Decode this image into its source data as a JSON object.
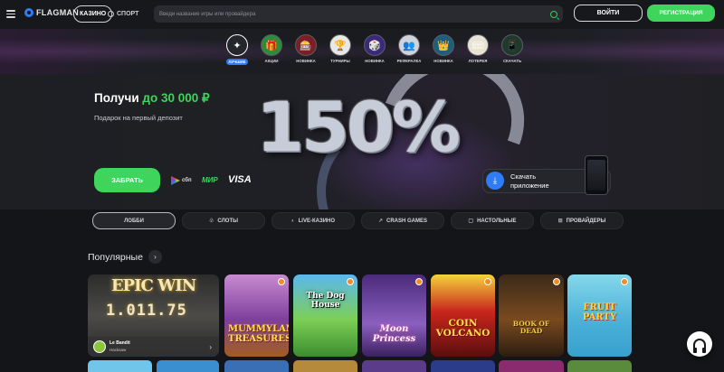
{
  "header": {
    "logo_text": "FLAGMAN",
    "nav_casino": "КАЗИНО",
    "nav_sport": "СПОРТ",
    "search_placeholder": "Введи название игры или провайдера",
    "login": "ВОЙТИ",
    "register": "РЕГИСТРАЦИЯ"
  },
  "categories": [
    {
      "label": "ЛУЧШИЕ",
      "icon": "star-icon"
    },
    {
      "label": "АКЦИИ",
      "icon": "gift-icon"
    },
    {
      "label": "НОВИНКА",
      "icon": "game-icon"
    },
    {
      "label": "ТУРНИРЫ",
      "icon": "trophy-icon"
    },
    {
      "label": "НОВИНКА",
      "icon": "game-icon"
    },
    {
      "label": "РЕФЕРАЛКА",
      "icon": "referral-icon"
    },
    {
      "label": "НОВИНКА",
      "icon": "game-icon"
    },
    {
      "label": "ЛОТЕРЕЯ",
      "icon": "lottery-icon"
    },
    {
      "label": "СКАЧАТЬ",
      "icon": "download-icon"
    }
  ],
  "banner": {
    "title_prefix": "Получи",
    "title_accent": "до 30 000 ₽",
    "subtitle": "Подарок на первый депозит",
    "big_text": "150%",
    "claim_button": "ЗАБРАТЬ",
    "pay_sbp": "сбп",
    "pay_mir": "МИР",
    "pay_visa": "VISA",
    "app_line1": "Скачать",
    "app_line2": "приложение"
  },
  "tabs": [
    {
      "label": "ЛОББИ",
      "icon": "",
      "active": true
    },
    {
      "label": "СЛОТЫ",
      "icon": "slots-icon"
    },
    {
      "label": "LIVE-КАЗИНО",
      "icon": "live-icon"
    },
    {
      "label": "CRASH GAMES",
      "icon": "crash-icon"
    },
    {
      "label": "НАСТОЛЬНЫЕ",
      "icon": "table-games-icon"
    },
    {
      "label": "ПРОВАЙДЕРЫ",
      "icon": "providers-icon"
    }
  ],
  "popular": {
    "title": "Популярные",
    "games": [
      {
        "name": "EPIC WIN",
        "counter": "1.011.75",
        "provider": "Le Bandit",
        "provider_sub": "Hacksaw"
      },
      {
        "name": "MUMMYLAND TREASURES"
      },
      {
        "name": "The Dog House"
      },
      {
        "name": "Moon Princess"
      },
      {
        "name": "COIN VOLCANO"
      },
      {
        "name": "BOOK OF DEAD"
      },
      {
        "name": "FRUIT PARTY"
      }
    ]
  }
}
